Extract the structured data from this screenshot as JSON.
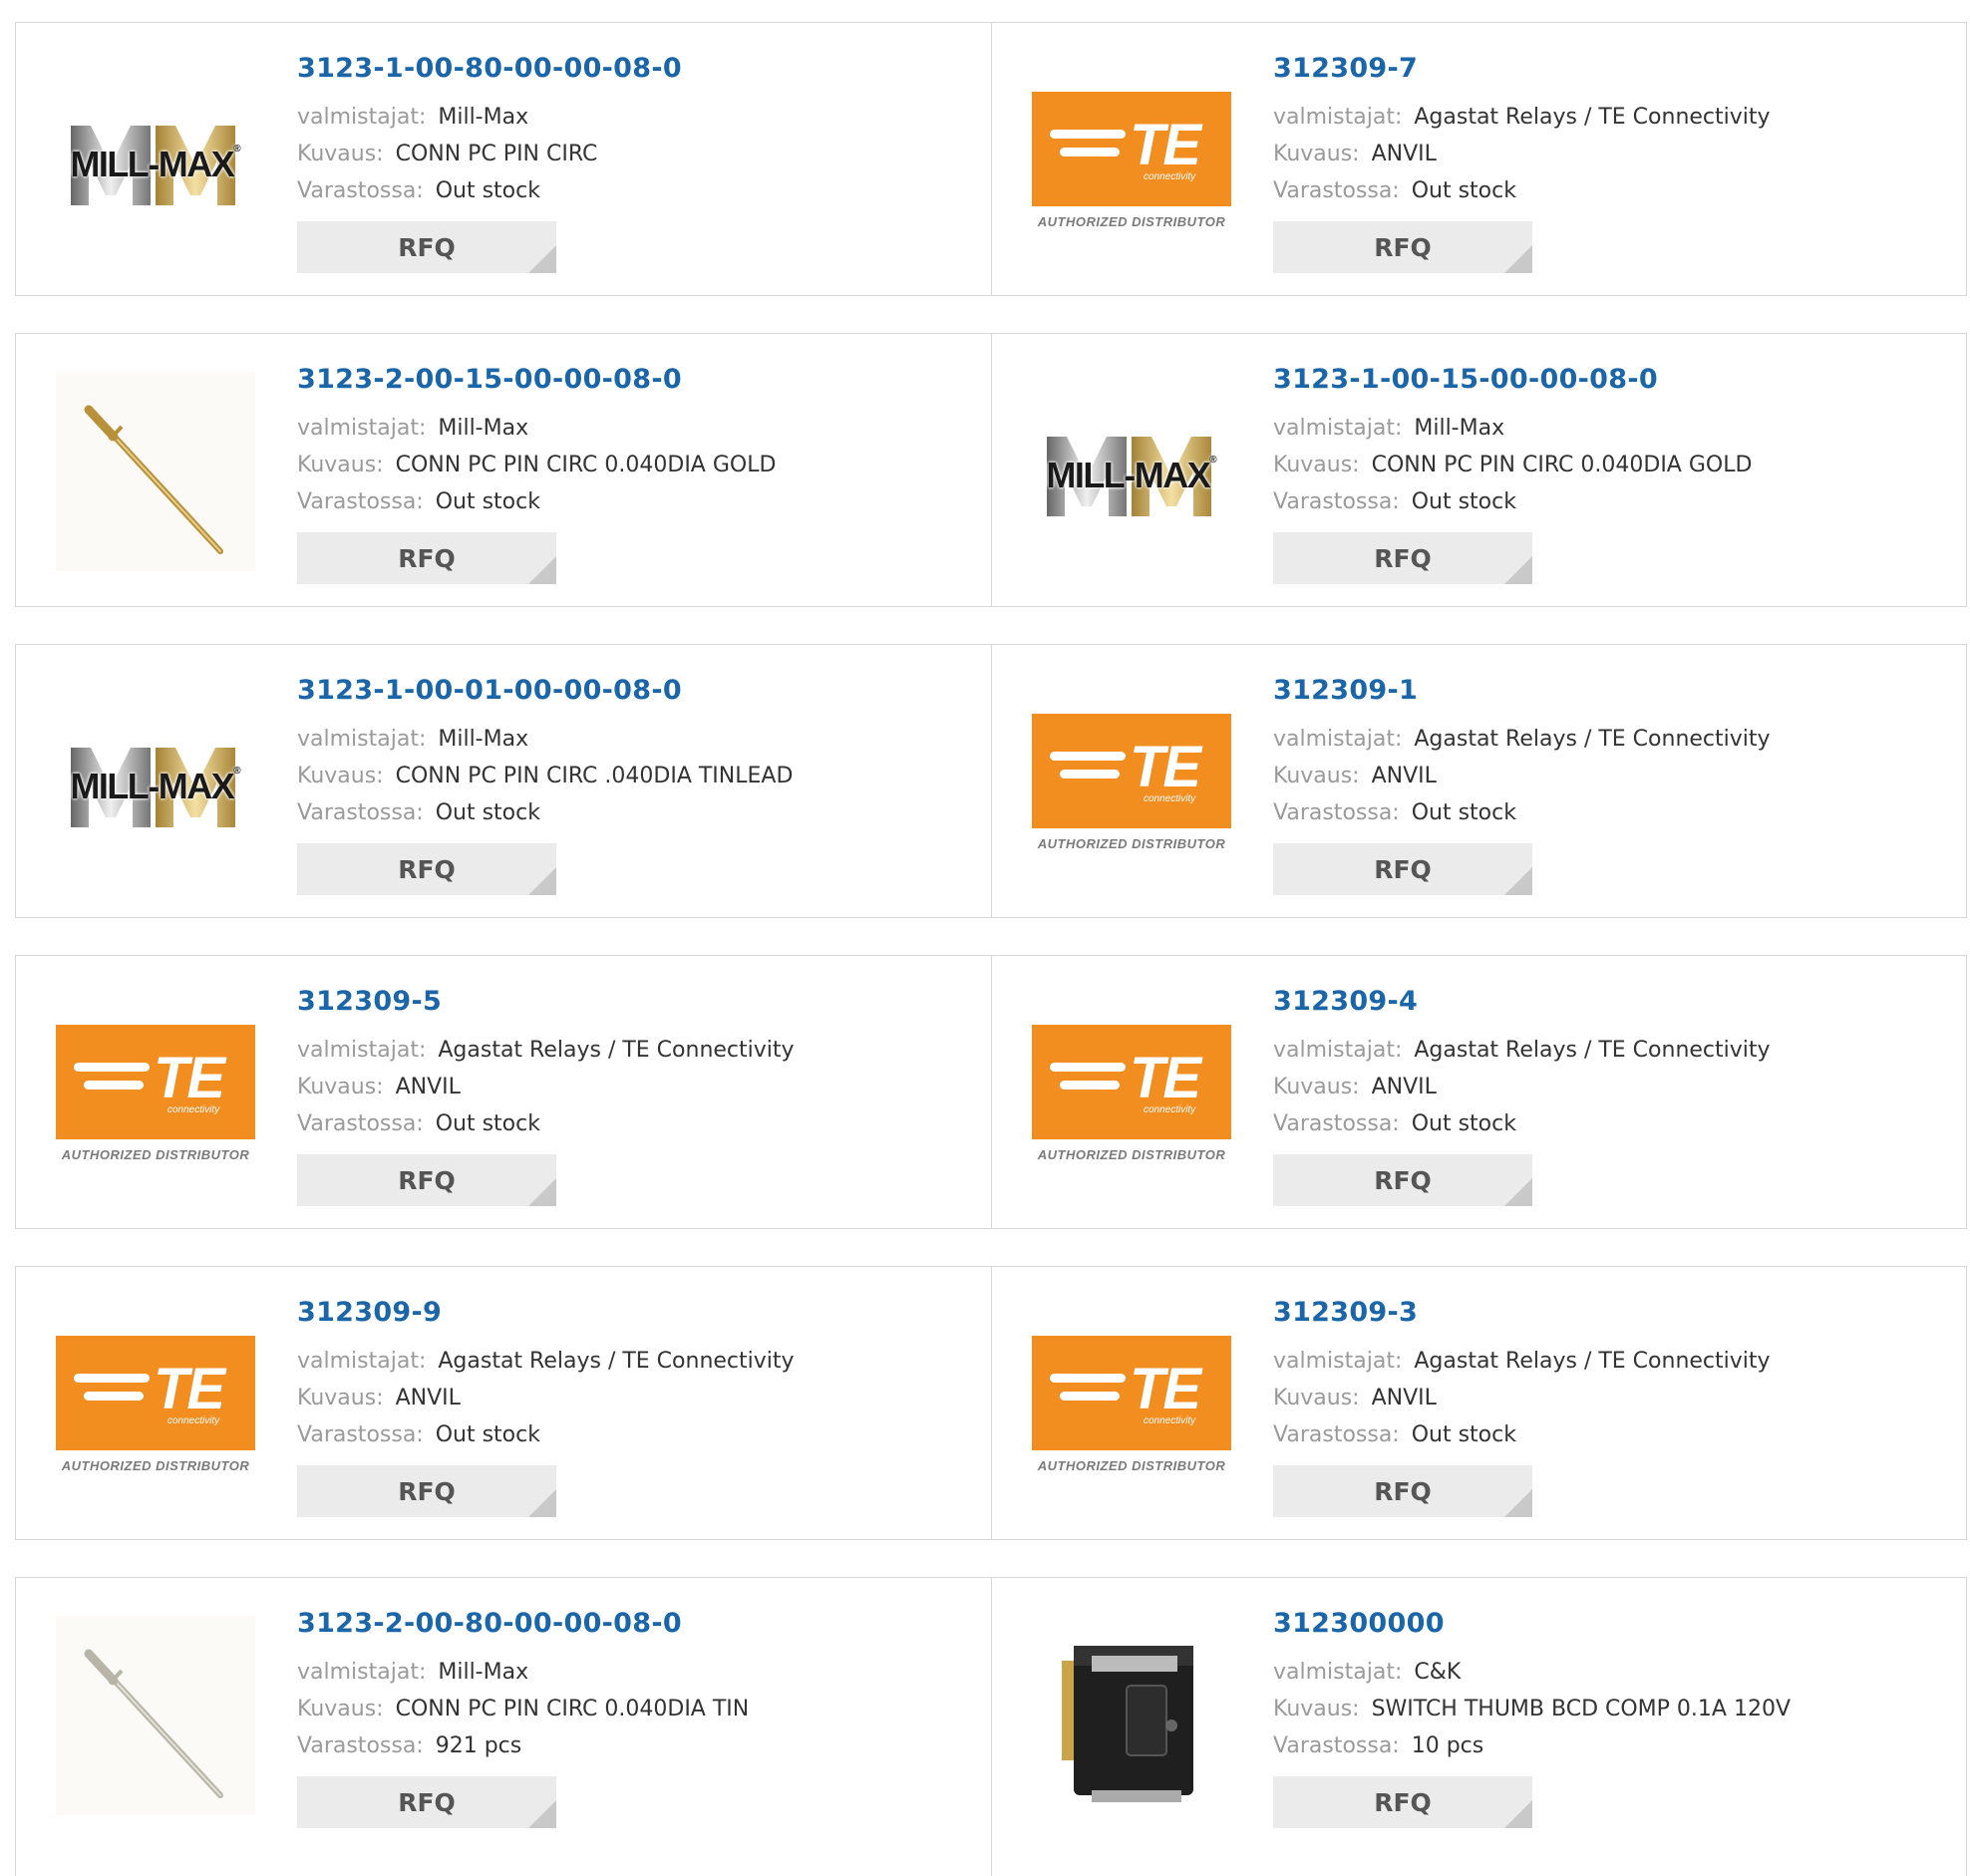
{
  "labels": {
    "manufacturer": "valmistajat:",
    "description": "Kuvaus:",
    "stock": "Varastossa:",
    "rfq": "RFQ"
  },
  "logos": {
    "millmax_text": "MILL-MAX",
    "millmax_reg": "®",
    "te_text": "TE",
    "te_sub": "connectivity",
    "te_authorized": "AUTHORIZED DISTRIBUTOR"
  },
  "products": [
    {
      "part": "3123-1-00-80-00-00-08-0",
      "manufacturer": "Mill-Max",
      "description": "CONN PC PIN CIRC",
      "stock": "Out stock",
      "image": "millmax-logo"
    },
    {
      "part": "312309-7",
      "manufacturer": "Agastat Relays / TE Connectivity",
      "description": "ANVIL",
      "stock": "Out stock",
      "image": "te-logo"
    },
    {
      "part": "3123-2-00-15-00-00-08-0",
      "manufacturer": "Mill-Max",
      "description": "CONN PC PIN CIRC 0.040DIA GOLD",
      "stock": "Out stock",
      "image": "gold-pin"
    },
    {
      "part": "3123-1-00-15-00-00-08-0",
      "manufacturer": "Mill-Max",
      "description": "CONN PC PIN CIRC 0.040DIA GOLD",
      "stock": "Out stock",
      "image": "millmax-logo"
    },
    {
      "part": "3123-1-00-01-00-00-08-0",
      "manufacturer": "Mill-Max",
      "description": "CONN PC PIN CIRC .040DIA TINLEAD",
      "stock": "Out stock",
      "image": "millmax-logo"
    },
    {
      "part": "312309-1",
      "manufacturer": "Agastat Relays / TE Connectivity",
      "description": "ANVIL",
      "stock": "Out stock",
      "image": "te-logo"
    },
    {
      "part": "312309-5",
      "manufacturer": "Agastat Relays / TE Connectivity",
      "description": "ANVIL",
      "stock": "Out stock",
      "image": "te-logo"
    },
    {
      "part": "312309-4",
      "manufacturer": "Agastat Relays / TE Connectivity",
      "description": "ANVIL",
      "stock": "Out stock",
      "image": "te-logo"
    },
    {
      "part": "312309-9",
      "manufacturer": "Agastat Relays / TE Connectivity",
      "description": "ANVIL",
      "stock": "Out stock",
      "image": "te-logo"
    },
    {
      "part": "312309-3",
      "manufacturer": "Agastat Relays / TE Connectivity",
      "description": "ANVIL",
      "stock": "Out stock",
      "image": "te-logo"
    },
    {
      "part": "3123-2-00-80-00-00-08-0",
      "manufacturer": "Mill-Max",
      "description": "CONN PC PIN CIRC 0.040DIA TIN",
      "stock": "921 pcs",
      "image": "tin-pin"
    },
    {
      "part": "312300000",
      "manufacturer": "C&K",
      "description": "SWITCH THUMB BCD COMP 0.1A 120V",
      "stock": "10 pcs",
      "image": "thumbwheel-switch"
    }
  ],
  "colors": {
    "link": "#1b66a8",
    "label": "#9a9a9a",
    "value": "#333333",
    "te_orange": "#f28d1f",
    "button_bg": "#ebebeb"
  }
}
